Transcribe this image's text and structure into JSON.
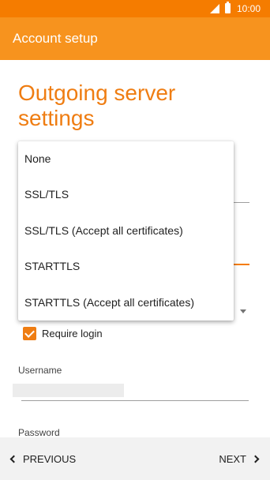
{
  "status_bar": {
    "time": "10:00",
    "icons": [
      "signal-icon",
      "battery-icon"
    ]
  },
  "app_bar": {
    "title": "Account setup"
  },
  "page": {
    "title": "Outgoing server settings"
  },
  "form": {
    "require_login_label": "Require login",
    "require_login_checked": true,
    "username_label": "Username",
    "password_label": "Password"
  },
  "security_dropdown": {
    "options": [
      "None",
      "SSL/TLS",
      "SSL/TLS (Accept all certificates)",
      "STARTTLS",
      "STARTTLS (Accept all certificates)"
    ]
  },
  "bottom_nav": {
    "previous_label": "PREVIOUS",
    "next_label": "NEXT"
  },
  "colors": {
    "accent": "#f7931e",
    "status_bar": "#f57c00",
    "title_text": "#ef7d12",
    "bottom_bar": "#f2f2f2"
  }
}
